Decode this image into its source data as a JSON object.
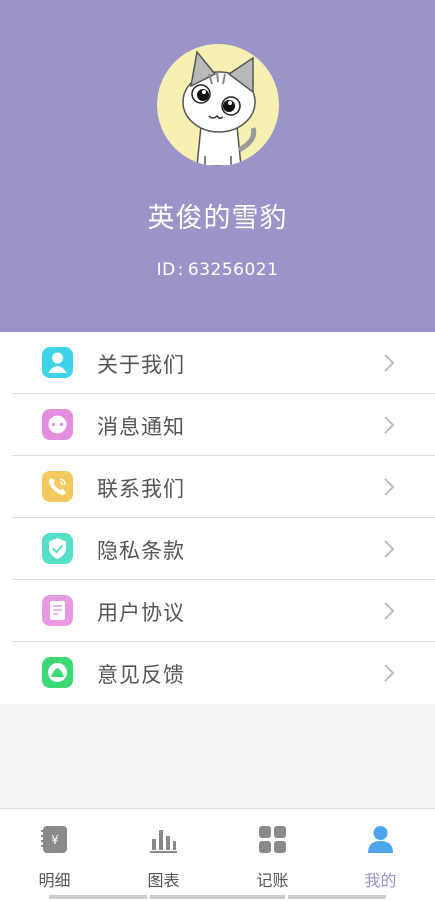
{
  "profile": {
    "username": "英俊的雪豹",
    "id_label": "ID",
    "id_sep": ":",
    "id_value": "63256021",
    "avatar_icon": "cat-avatar"
  },
  "menu": {
    "items": [
      {
        "label": "关于我们",
        "icon": "user-icon",
        "color": "#3fd3e8"
      },
      {
        "label": "消息通知",
        "icon": "chat-icon",
        "color": "#e38ddf"
      },
      {
        "label": "联系我们",
        "icon": "phone-icon",
        "color": "#f3c85c"
      },
      {
        "label": "隐私条款",
        "icon": "shield-icon",
        "color": "#55dfc7"
      },
      {
        "label": "用户协议",
        "icon": "document-icon",
        "color": "#e99ae2"
      },
      {
        "label": "意见反馈",
        "icon": "feedback-icon",
        "color": "#3ed977"
      }
    ]
  },
  "tabbar": {
    "tabs": [
      {
        "label": "明细",
        "icon": "ledger-icon",
        "active": false
      },
      {
        "label": "图表",
        "icon": "bar-chart-icon",
        "active": false
      },
      {
        "label": "记账",
        "icon": "grid-icon",
        "active": false
      },
      {
        "label": "我的",
        "icon": "person-icon",
        "active": true
      }
    ]
  },
  "colors": {
    "header_bg": "#9a94c9",
    "active_tab": "#9a94c9",
    "inactive_tab": "#555555",
    "active_icon": "#4da5ee"
  }
}
